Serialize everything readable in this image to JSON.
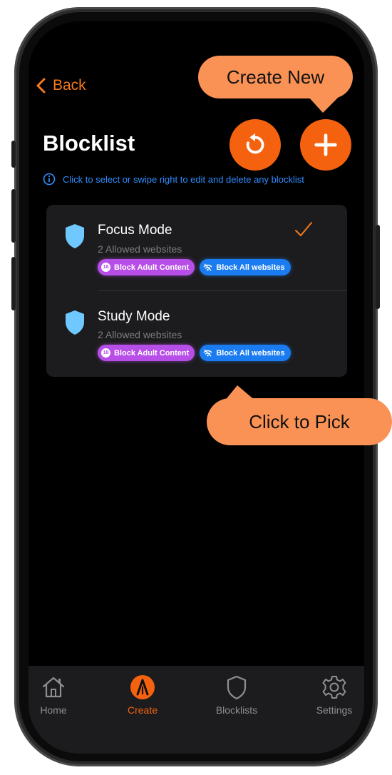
{
  "nav": {
    "back_label": "Back"
  },
  "header": {
    "title": "Blocklist",
    "info_text": "Click to select or swipe right to edit and delete any blocklist"
  },
  "blocklists": [
    {
      "name": "Focus Mode",
      "subtitle": "2 Allowed websites",
      "selected": true,
      "tags": [
        {
          "label": "Block Adult Content",
          "badge": "18",
          "color": "#b74ee8"
        },
        {
          "label": "Block All websites",
          "color": "#1a7cf0"
        }
      ]
    },
    {
      "name": "Study Mode",
      "subtitle": "2 Allowed websites",
      "selected": false,
      "tags": [
        {
          "label": "Block Adult Content",
          "badge": "18",
          "color": "#b74ee8"
        },
        {
          "label": "Block All websites",
          "color": "#1a7cf0"
        }
      ]
    }
  ],
  "tabbar": {
    "items": [
      {
        "label": "Home",
        "icon": "home-icon",
        "active": false
      },
      {
        "label": "Create",
        "icon": "create-icon",
        "active": true
      },
      {
        "label": "Blocklists",
        "icon": "shield-icon",
        "active": false
      },
      {
        "label": "Settings",
        "icon": "gear-icon",
        "active": false
      }
    ]
  },
  "callouts": {
    "create_new": "Create New",
    "click_to_pick": "Click to Pick"
  },
  "colors": {
    "accent": "#f5620f",
    "back_text": "#f57a1c",
    "info_blue": "#2f8cff",
    "shield": "#6fc8ff",
    "callout": "#fb9255",
    "card_bg": "#1c1c1e"
  }
}
